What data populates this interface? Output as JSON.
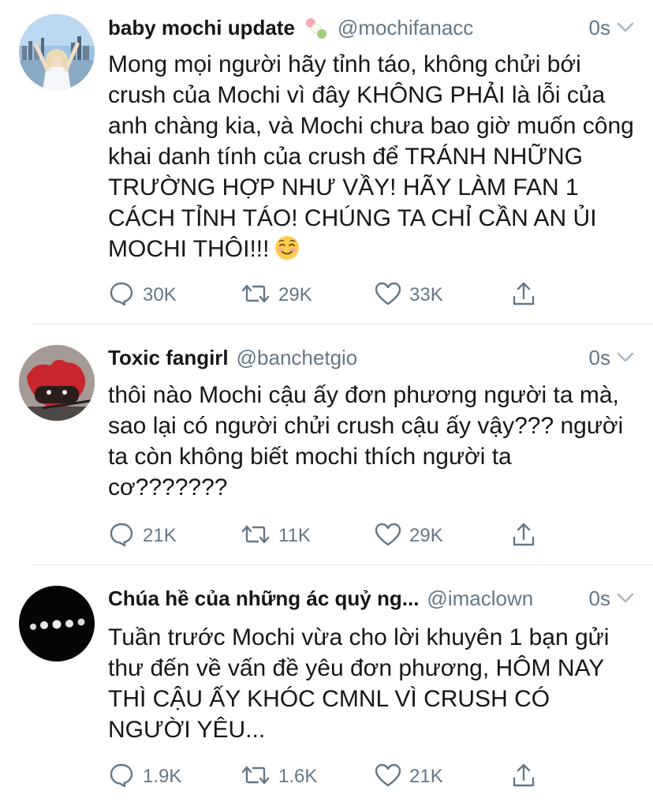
{
  "tweets": [
    {
      "name": "baby mochi update",
      "handle": "@mochifanacc",
      "time": "0s",
      "body": "Mong mọi người hãy tỉnh táo, không chửi bới crush của Mochi vì đây KHÔNG PHẢI là lỗi của anh chàng kia, và Mochi chưa bao giờ muốn công khai danh tính của crush để TRÁNH NHỮNG TRƯỜNG HỢP NHƯ VẦY! HÃY LÀM FAN 1 CÁCH TỈNH TÁO! CHÚNG TA CHỈ CẦN AN ỦI MOCHI THÔI!!!",
      "replies": "30K",
      "retweets": "29K",
      "likes": "33K"
    },
    {
      "name": "Toxic fangirl",
      "handle": "@banchetgio",
      "time": "0s",
      "body": "thôi nào Mochi cậu ấy đơn phương người ta mà, sao lại có người chửi crush cậu ấy vậy??? người ta còn không biết mochi thích người ta cơ???????",
      "replies": "21K",
      "retweets": "11K",
      "likes": "29K"
    },
    {
      "name": "Chúa hề của những ác quỷ ng...",
      "handle": "@imaclown",
      "time": "0s",
      "body": "Tuần trước Mochi vừa cho lời khuyên 1 bạn gửi thư đến về vấn đề yêu đơn phương, HÔM NAY THÌ CẬU ẤY KHÓC CMNL VÌ CRUSH CÓ NGƯỜI YÊU...",
      "replies": "1.9K",
      "retweets": "1.6K",
      "likes": "21K"
    }
  ],
  "icons": {
    "reply": "reply-icon",
    "retweet": "retweet-icon",
    "like": "like-icon",
    "share": "share-icon",
    "menu": "chevron-down-icon"
  },
  "colors": {
    "text": "#14171a",
    "muted": "#657786",
    "divider": "#e1e8ed"
  }
}
